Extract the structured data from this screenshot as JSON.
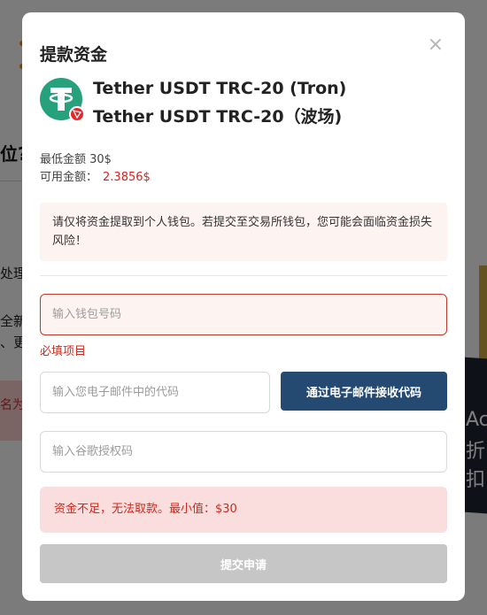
{
  "background": {
    "title_fragment": "位?",
    "line1_fragment": "处理",
    "line2_fragment": "全新",
    "line3_fragment": "、更",
    "pink_fragment": "名为",
    "dark_fragment1": "Ac",
    "dark_fragment2": "折扣"
  },
  "modal": {
    "title": "提款资金",
    "close_symbol": "×",
    "coin": {
      "name_line1": "Tether USDT TRC-20 (Tron)",
      "name_line2": "Tether USDT TRC-20（波场)",
      "brand_color": "#26a17b",
      "badge_color": "#e8262b"
    },
    "min_amount_label": "最低金额 30$",
    "available_label": "可用金额：",
    "available_value": "2.3856$",
    "warning_text": "请仅将资金提取到个人钱包。若提交至交易所钱包，您可能会面临资金损失风险！",
    "wallet_placeholder": "输入钱包号码",
    "wallet_error": "必填项目",
    "email_code_placeholder": "输入您电子邮件中的代码",
    "email_code_button": "通过电子邮件接收代码",
    "google_code_placeholder": "输入谷歌授权码",
    "insufficient_alert": "资金不足，无法取款。最小值：$30",
    "submit_button": "提交申请"
  }
}
